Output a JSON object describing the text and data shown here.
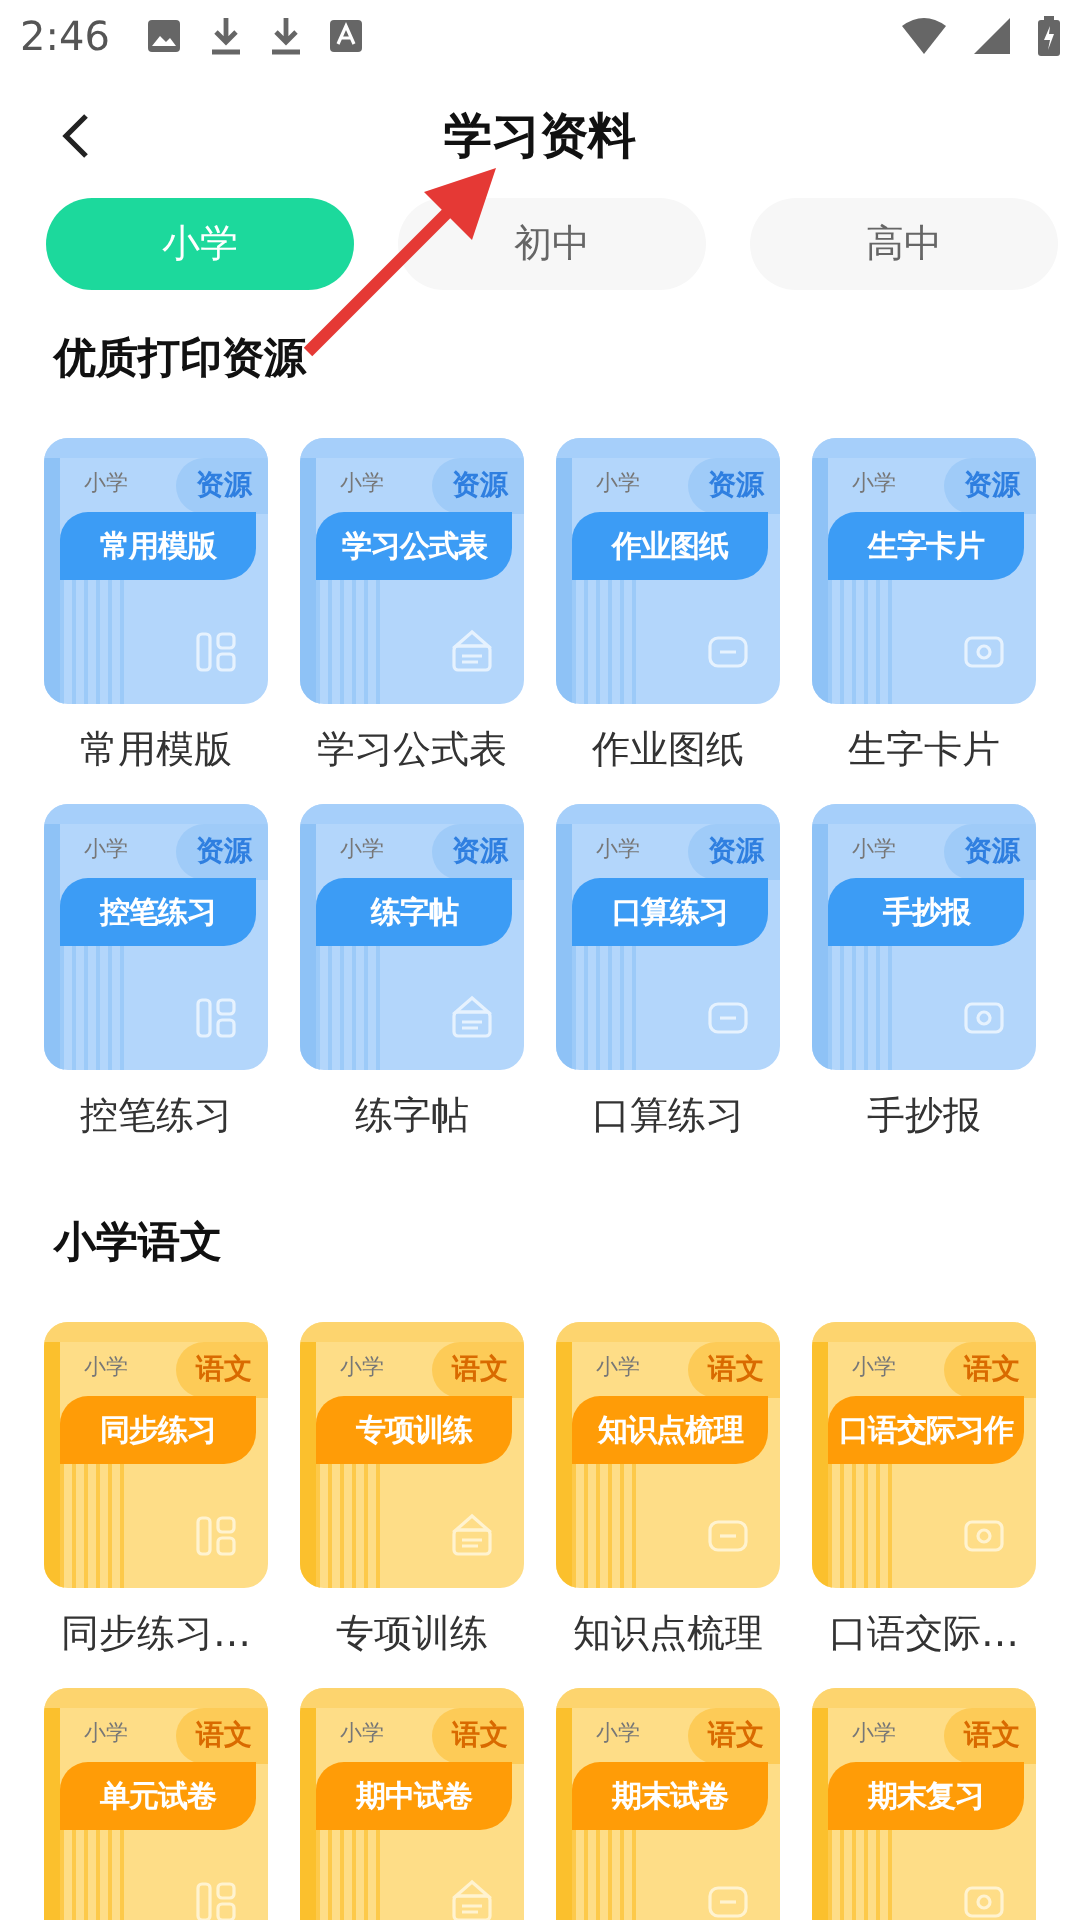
{
  "status_bar": {
    "time": "2:46"
  },
  "header": {
    "title": "学习资料"
  },
  "tabs": [
    {
      "label": "小学",
      "selected": true
    },
    {
      "label": "初中",
      "selected": false
    },
    {
      "label": "高中",
      "selected": false
    }
  ],
  "sections": [
    {
      "title": "优质打印资源",
      "kind": "resource",
      "items": [
        {
          "grade": "小学",
          "tag": "资源",
          "cover_title": "常用模版",
          "label": "常用模版"
        },
        {
          "grade": "小学",
          "tag": "资源",
          "cover_title": "学习公式表",
          "label": "学习公式表"
        },
        {
          "grade": "小学",
          "tag": "资源",
          "cover_title": "作业图纸",
          "label": "作业图纸"
        },
        {
          "grade": "小学",
          "tag": "资源",
          "cover_title": "生字卡片",
          "label": "生字卡片"
        },
        {
          "grade": "小学",
          "tag": "资源",
          "cover_title": "控笔练习",
          "label": "控笔练习"
        },
        {
          "grade": "小学",
          "tag": "资源",
          "cover_title": "练字帖",
          "label": "练字帖"
        },
        {
          "grade": "小学",
          "tag": "资源",
          "cover_title": "口算练习",
          "label": "口算练习"
        },
        {
          "grade": "小学",
          "tag": "资源",
          "cover_title": "手抄报",
          "label": "手抄报"
        }
      ]
    },
    {
      "title": "小学语文",
      "kind": "subject",
      "items": [
        {
          "grade": "小学",
          "tag": "语文",
          "cover_title": "同步练习",
          "label": "同步练习…"
        },
        {
          "grade": "小学",
          "tag": "语文",
          "cover_title": "专项训练",
          "label": "专项训练"
        },
        {
          "grade": "小学",
          "tag": "语文",
          "cover_title": "知识点梳理",
          "label": "知识点梳理"
        },
        {
          "grade": "小学",
          "tag": "语文",
          "cover_title": "口语交际习作",
          "label": "口语交际…"
        },
        {
          "grade": "小学",
          "tag": "语文",
          "cover_title": "单元试卷"
        },
        {
          "grade": "小学",
          "tag": "语文",
          "cover_title": "期中试卷"
        },
        {
          "grade": "小学",
          "tag": "语文",
          "cover_title": "期末试卷"
        },
        {
          "grade": "小学",
          "tag": "语文",
          "cover_title": "期末复习"
        }
      ]
    }
  ]
}
